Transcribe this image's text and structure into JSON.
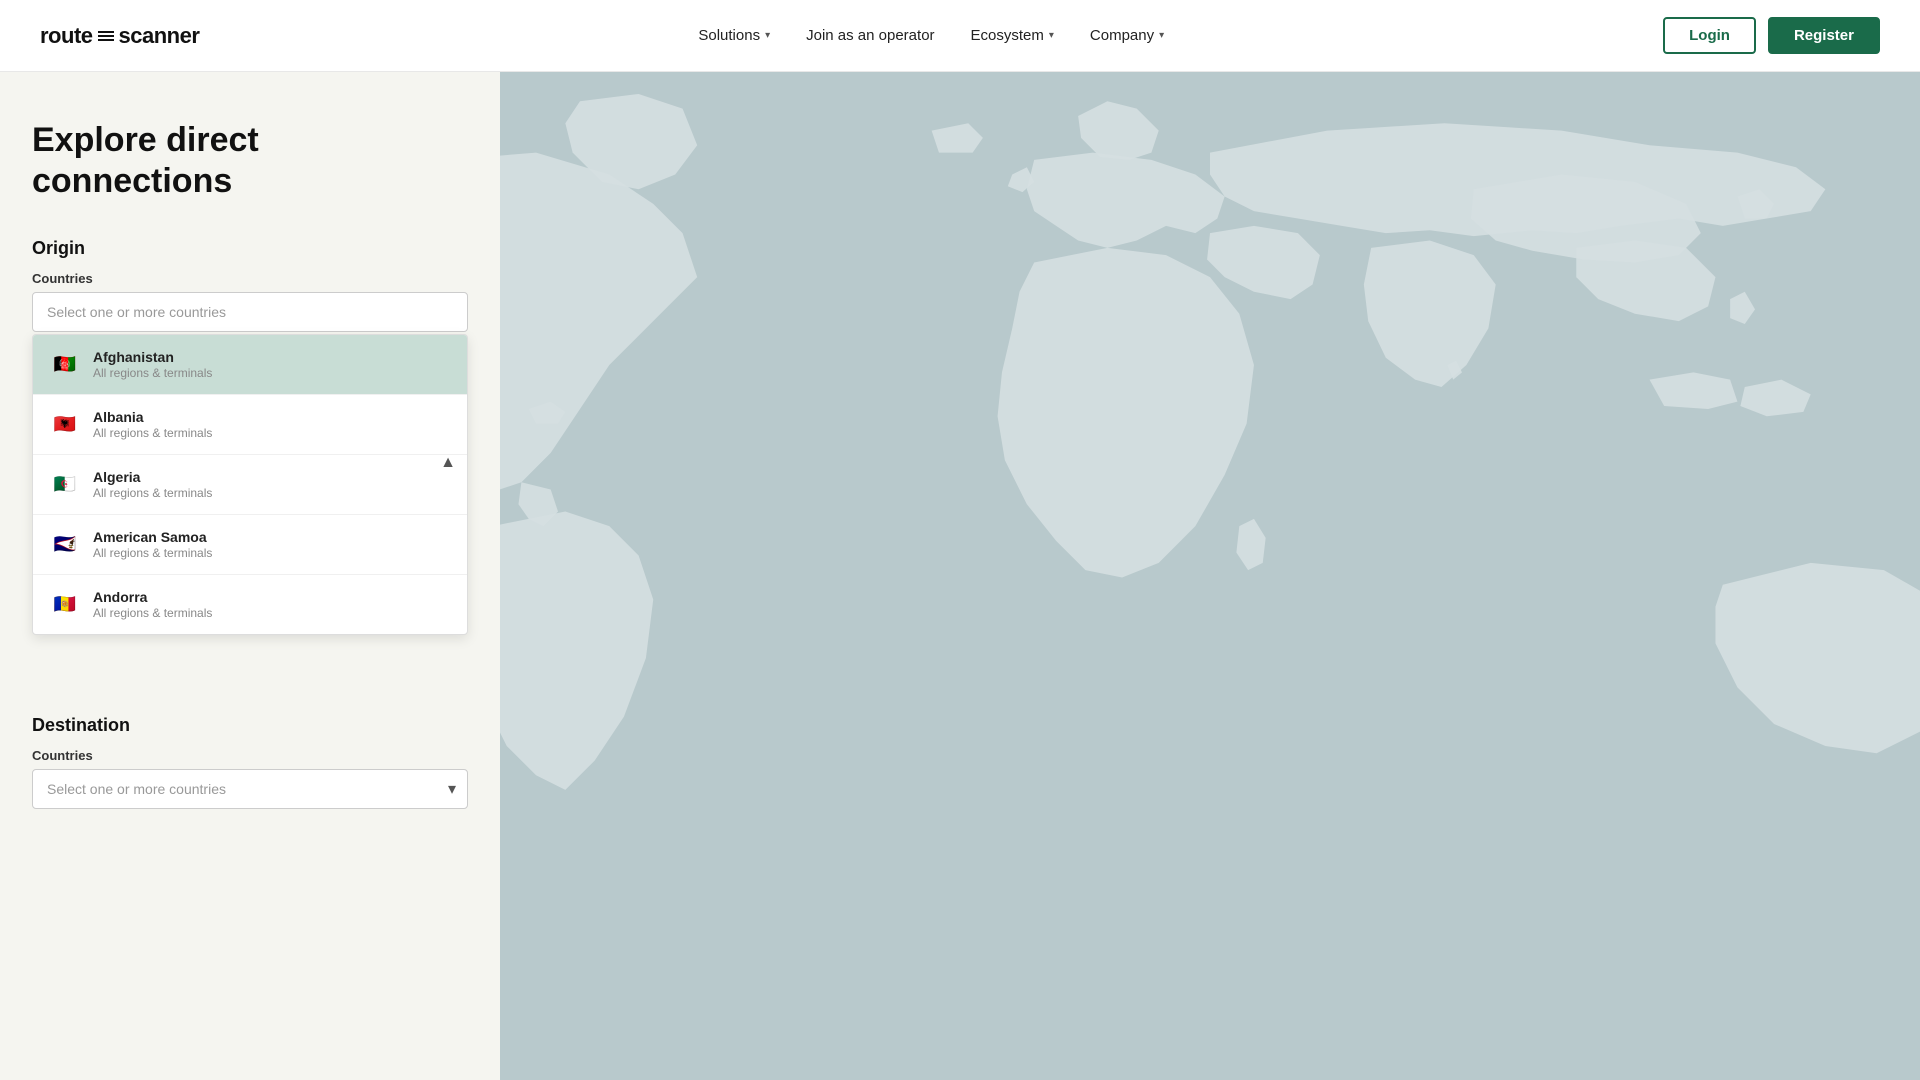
{
  "header": {
    "logo_text": "route",
    "logo_suffix": "scanner",
    "nav": [
      {
        "label": "Solutions",
        "has_dropdown": true
      },
      {
        "label": "Join as an operator",
        "has_dropdown": false
      },
      {
        "label": "Ecosystem",
        "has_dropdown": true
      },
      {
        "label": "Company",
        "has_dropdown": true
      }
    ],
    "login_label": "Login",
    "register_label": "Register"
  },
  "main": {
    "title": "Explore direct connections",
    "origin": {
      "section_label": "Origin",
      "countries_label": "Countries",
      "countries_placeholder": "Select one or more countries",
      "dropdown_open": true,
      "countries": [
        {
          "name": "Afghanistan",
          "sub": "All regions & terminals",
          "flag": "🇦🇫",
          "selected": true
        },
        {
          "name": "Albania",
          "sub": "All regions & terminals",
          "flag": "🇦🇱",
          "selected": false
        },
        {
          "name": "Algeria",
          "sub": "All regions & terminals",
          "flag": "🇩🇿",
          "selected": false
        },
        {
          "name": "American Samoa",
          "sub": "All regions & terminals",
          "flag": "🇦🇸",
          "selected": false
        },
        {
          "name": "Andorra",
          "sub": "All regions & terminals",
          "flag": "🇦🇩",
          "selected": false
        }
      ]
    },
    "destination": {
      "section_label": "Destination",
      "countries_label": "Countries",
      "countries_placeholder": "Select one or more countries"
    }
  },
  "colors": {
    "brand_green": "#1a6b4a",
    "selected_bg": "#c8ddd5",
    "map_bg": "#b8c9cc",
    "land_color": "#dde5e7",
    "ocean_color": "#b8c9cc"
  }
}
